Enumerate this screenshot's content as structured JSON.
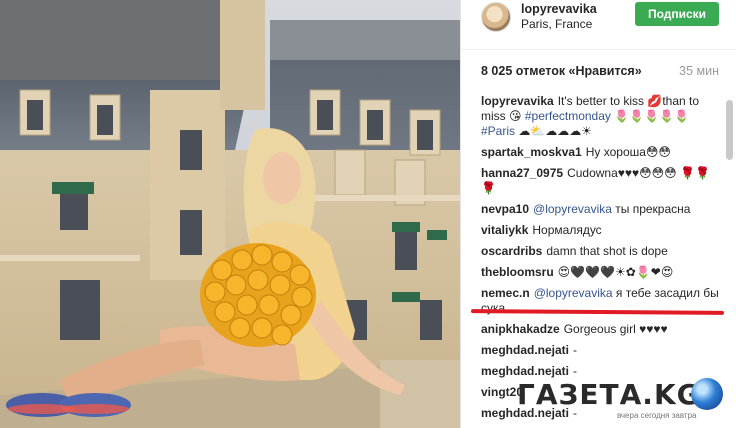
{
  "post": {
    "username": "lopyrevavika",
    "location": "Paris, France",
    "follow_label": "Подписки",
    "likes": "8 025 отметок «Нравится»",
    "time": "35 мин"
  },
  "comments": [
    {
      "user": "lopyrevavika",
      "parts": [
        {
          "t": "text",
          "v": "It's better to kiss 💋than to miss 😘 "
        },
        {
          "t": "tag",
          "v": "#perfectmonday"
        },
        {
          "t": "text",
          "v": " 🌷🌷🌷🌷🌷 "
        },
        {
          "t": "tag",
          "v": "#Paris"
        },
        {
          "t": "text",
          "v": " ☁⛅☁☁☁☀"
        }
      ]
    },
    {
      "user": "spartak_moskva1",
      "parts": [
        {
          "t": "text",
          "v": "Ну хороша😳😳"
        }
      ]
    },
    {
      "user": "hanna27_0975",
      "parts": [
        {
          "t": "text",
          "v": "Cudowna♥♥♥😳😳😳 🌹🌹🌹"
        }
      ]
    },
    {
      "user": "nevpa10",
      "parts": [
        {
          "t": "tag",
          "v": "@lopyrevavika"
        },
        {
          "t": "text",
          "v": " ты прекрасна"
        }
      ]
    },
    {
      "user": "vitaliykk",
      "parts": [
        {
          "t": "text",
          "v": "Нормалядус"
        }
      ]
    },
    {
      "user": "oscardribs",
      "parts": [
        {
          "t": "text",
          "v": "damn that shot is dope"
        }
      ]
    },
    {
      "user": "thebloomsru",
      "parts": [
        {
          "t": "text",
          "v": "😍🖤🖤🖤☀✿🌷❤😍"
        }
      ]
    },
    {
      "user": "nemec.n",
      "parts": [
        {
          "t": "tag",
          "v": "@lopyrevavika"
        },
        {
          "t": "text",
          "v": " я тебе засадил бы сука"
        }
      ]
    },
    {
      "user": "anipkhakadze",
      "parts": [
        {
          "t": "text",
          "v": "Gorgeous girl ♥♥♥♥"
        }
      ]
    },
    {
      "user": "meghdad.nejati",
      "parts": [
        {
          "t": "text",
          "v": "-"
        }
      ]
    },
    {
      "user": "meghdad.nejati",
      "parts": [
        {
          "t": "text",
          "v": "-"
        }
      ]
    },
    {
      "user": "vingt20",
      "parts": [
        {
          "t": "text",
          "v": ""
        }
      ]
    },
    {
      "user": "meghdad.nejati",
      "parts": [
        {
          "t": "text",
          "v": "-"
        }
      ]
    }
  ],
  "watermark": {
    "brand": "ГАЗЕТА.KG",
    "tagline": "вчера сегодня завтра"
  },
  "colors": {
    "follow_button": "#3aaa53",
    "link": "#36558f",
    "annotation_line": "#e01b24"
  }
}
